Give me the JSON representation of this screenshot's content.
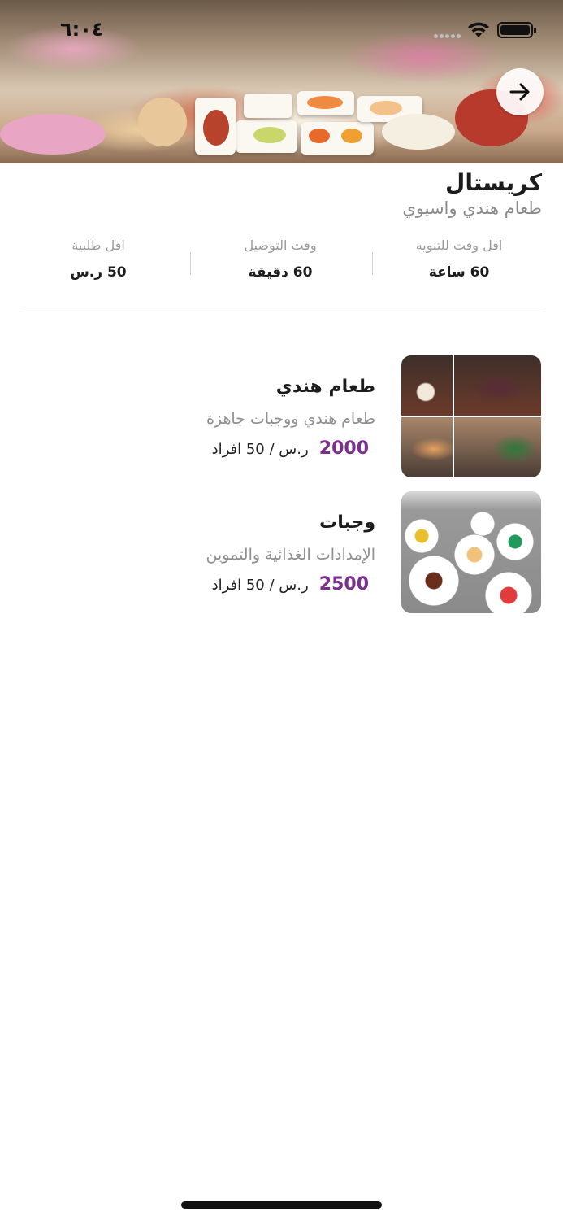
{
  "status_bar": {
    "time": "٦:٠٤"
  },
  "restaurant": {
    "name": "كريستال",
    "cuisine": "طعام هندي واسيوي"
  },
  "stats": [
    {
      "label": "اقل وقت للتنويه",
      "value": "60 ساعة"
    },
    {
      "label": "وقت التوصيل",
      "value": "60 دقيقة"
    },
    {
      "label": "اقل طلبية",
      "value": "50 ر.س"
    }
  ],
  "menu_items": [
    {
      "name": "طعام هندي",
      "description": "طعام هندي ووجبات جاهزة",
      "price": "2000",
      "unit": "ر.س / 50 افراد"
    },
    {
      "name": "وجبات",
      "description": "الإمدادات الغذائية والتموين",
      "price": "2500",
      "unit": "ر.س / 50 افراد"
    }
  ],
  "icons": {
    "back": "arrow-right-icon",
    "wifi": "wifi-icon",
    "battery": "battery-icon",
    "signal": "signal-icon"
  },
  "colors": {
    "accent": "#7b2f8e",
    "muted": "#8f8f8f"
  }
}
